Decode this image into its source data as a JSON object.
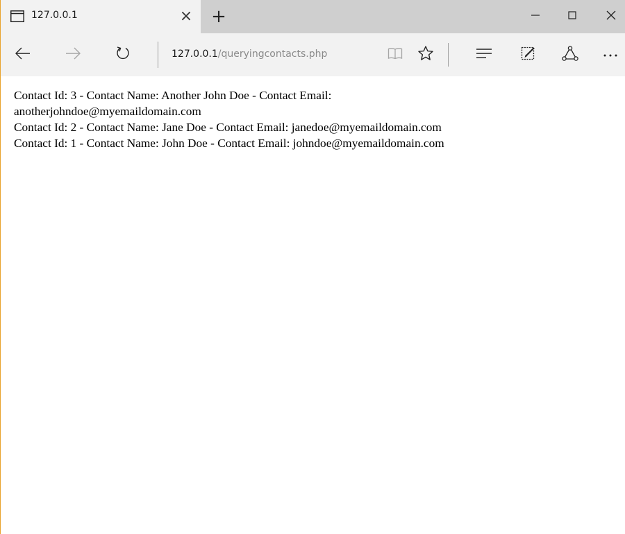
{
  "tab": {
    "title": "127.0.0.1",
    "close_glyph": "×",
    "new_tab_glyph": "+"
  },
  "address": {
    "host": "127.0.0.1",
    "path": "/queryingcontacts.php"
  },
  "icons": {
    "tab": "tab-page-icon",
    "back": "back-arrow-icon",
    "forward": "forward-arrow-icon",
    "refresh": "refresh-icon",
    "reading_view": "reading-view-icon",
    "favorite": "star-icon",
    "hub": "hub-icon",
    "note": "web-note-icon",
    "share": "share-icon",
    "more": "more-icon",
    "minimize": "minimize-icon",
    "maximize": "maximize-icon",
    "close": "close-icon"
  },
  "content": {
    "lines": [
      "Contact Id: 3 - Contact Name: Another John Doe - Contact Email:",
      "anotherjohndoe@myemaildomain.com",
      "Contact Id: 2 - Contact Name: Jane Doe - Contact Email: janedoe@myemaildomain.com",
      "Contact Id: 1 - Contact Name: John Doe - Contact Email: johndoe@myemaildomain.com"
    ]
  },
  "colors": {
    "window_border": "#e8a22b",
    "titlebar": "#cfcfcf",
    "toolbar": "#f2f2f2",
    "url_path": "#8a8a8a"
  }
}
